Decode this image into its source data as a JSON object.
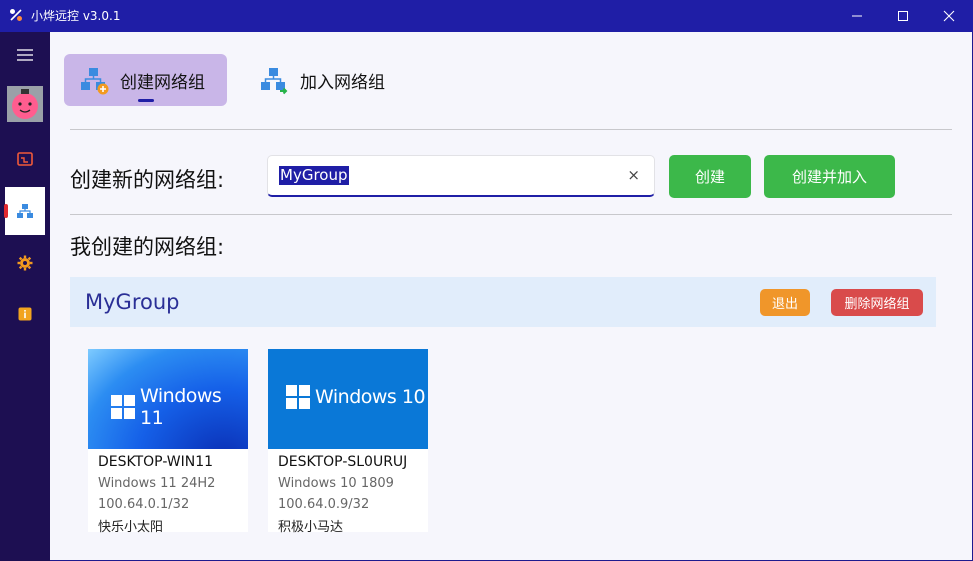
{
  "window": {
    "title": "小烨远控 v3.0.1",
    "controls": [
      "minimize-icon",
      "maximize-icon",
      "close-icon"
    ]
  },
  "sidebar": {
    "items": [
      {
        "name": "menu-icon",
        "active": false
      },
      {
        "name": "avatar",
        "active": false
      },
      {
        "name": "remote-desktop-icon",
        "active": false
      },
      {
        "name": "network-icon",
        "active": true
      },
      {
        "name": "settings-icon",
        "active": false
      },
      {
        "name": "info-icon",
        "active": false
      }
    ]
  },
  "tabs": [
    {
      "label": "创建网络组",
      "icon": "network-add-icon",
      "active": true
    },
    {
      "label": "加入网络组",
      "icon": "network-join-icon",
      "active": false
    }
  ],
  "create_form": {
    "label": "创建新的网络组:",
    "input_value": "MyGroup",
    "clear_icon": "×",
    "create_button": "创建",
    "create_join_button": "创建并加入"
  },
  "my_groups": {
    "title": "我创建的网络组:",
    "groups": [
      {
        "name": "MyGroup",
        "exit_button": "退出",
        "delete_button": "删除网络组",
        "devices": [
          {
            "banner": "Windows 11",
            "hostname": "DESKTOP-WIN11",
            "os": "Windows 11 24H2",
            "ip": "100.64.0.1/32",
            "nickname": "快乐小太阳"
          },
          {
            "banner": "Windows 10",
            "hostname": "DESKTOP-SL0URUJ",
            "os": "Windows 10 1809",
            "ip": "100.64.0.9/32",
            "nickname": "积极小马达"
          }
        ]
      }
    ]
  },
  "colors": {
    "titlebar": "#1f1ea6",
    "sidebar": "#1d0f52",
    "active_tab": "#c9b6e8",
    "green_button": "#3cb84a",
    "exit_button": "#f0962a",
    "delete_button": "#d94b4b",
    "group_bar": "#e1edfb"
  }
}
